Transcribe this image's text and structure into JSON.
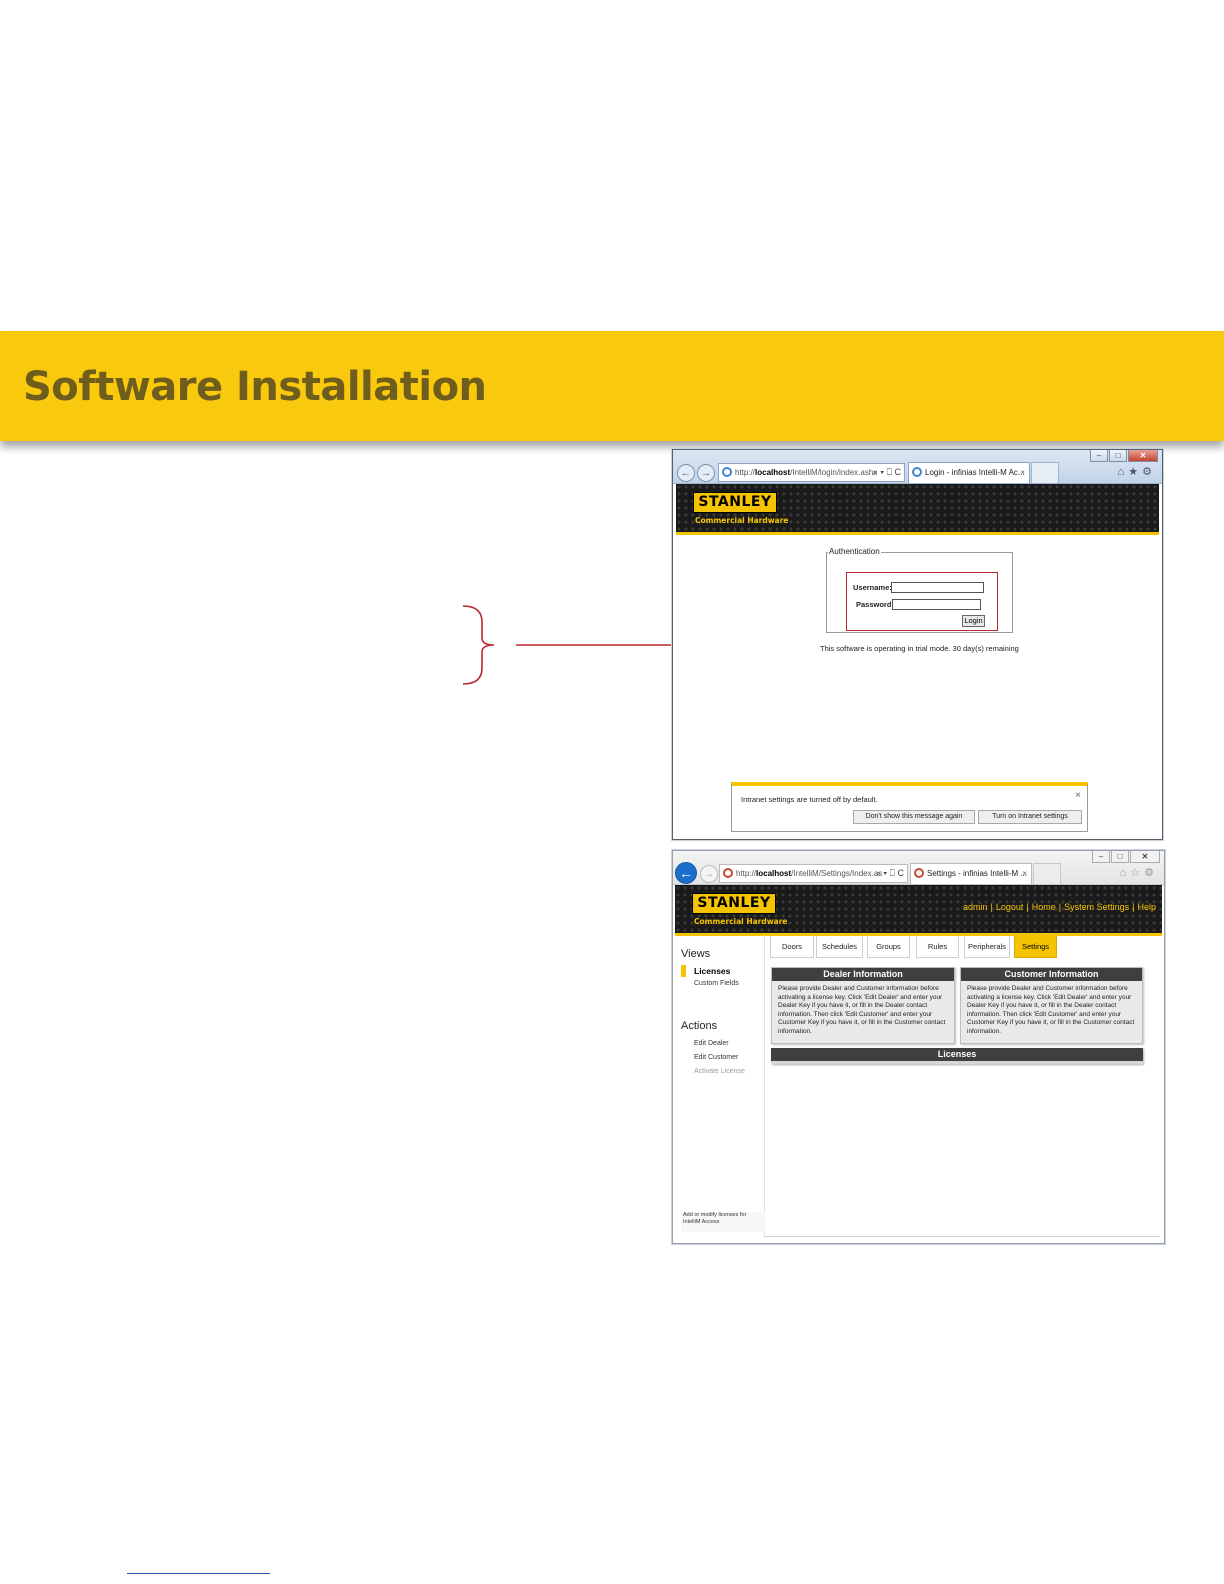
{
  "slide": {
    "title": "Software Installation"
  },
  "login_window": {
    "address": {
      "prefix": "http://",
      "host": "localhost",
      "path": "/IntelliM/login/index.ashx",
      "tools": "⌕ ▾ ⎕ C"
    },
    "tab_title": "Login - infinias Intelli-M Ac...",
    "logo_text": "STANLEY",
    "logo_subtitle": "Commercial Hardware",
    "auth": {
      "legend": "Authentication",
      "username_label": "Username:",
      "password_label": "Password:",
      "login_button": "Login"
    },
    "trial_message": "This software is operating in trial mode. 30 day(s) remaining",
    "notification": {
      "text": "Intranet settings are turned off by default.",
      "dont_show_button": "Don't show this message again",
      "turn_on_button": "Turn on Intranet settings"
    }
  },
  "settings_window": {
    "address": {
      "prefix": "http://",
      "host": "localhost",
      "path": "/IntelliM/Settings/Index.as",
      "tools": "⌕ ▾ ⎕ C"
    },
    "tab_title": "Settings - infinias Intelli-M ...",
    "logo_text": "STANLEY",
    "logo_subtitle": "Commercial Hardware",
    "top_links": [
      "admin",
      "Logout",
      "Home",
      "System Settings",
      "Help"
    ],
    "app_tabs": [
      "Doors",
      "Schedules",
      "Groups",
      "Rules",
      "Peripherals",
      "Settings"
    ],
    "sidebar": {
      "views_title": "Views",
      "views": [
        "Licenses",
        "Custom Fields"
      ],
      "actions_title": "Actions",
      "actions": [
        "Edit Dealer",
        "Edit Customer",
        "Activate License"
      ],
      "help_text": "Add or modify licenses for IntelliM Access"
    },
    "dealer_panel": {
      "title": "Dealer Information",
      "body": "Please provide Dealer and Customer information before activating a license key. Click 'Edit Dealer' and enter your Dealer Key if you have it, or fill in the Dealer contact information. Then click 'Edit Customer' and enter your Customer Key if you have it, or fill in the Customer contact information."
    },
    "customer_panel": {
      "title": "Customer Information",
      "body": "Please provide Dealer and Customer information before activating a license key. Click 'Edit Dealer' and enter your Dealer Key if you have it, or fill in the Dealer contact information. Then click 'Edit Customer' and enter your Customer Key if you have it, or fill in the Customer contact information."
    },
    "licenses_panel": {
      "title": "Licenses"
    }
  },
  "colors": {
    "band": "#f9c90d",
    "title_text": "#6e5d1c",
    "stanley_yellow": "#f5c400",
    "callout_red": "#b8282f"
  }
}
